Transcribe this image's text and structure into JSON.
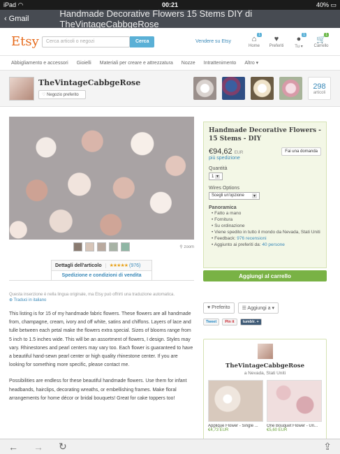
{
  "status": {
    "carrier": "iPad",
    "wifi_icon": "wifi-icon",
    "time": "00:21",
    "battery": "40%"
  },
  "nav": {
    "back_label": "Gmail",
    "title": "Handmade Decorative Flowers 15 Stems DIY di TheVintageCabbgeRose"
  },
  "header": {
    "logo": "Etsy",
    "search_placeholder": "Cerca articoli o negozi",
    "search_button": "Cerca",
    "sell_link": "Vendere su Etsy",
    "icons": [
      {
        "label": "Home",
        "badge": "1",
        "glyph": "⌂"
      },
      {
        "label": "Preferiti",
        "badge": "",
        "glyph": "♥"
      },
      {
        "label": "Tu ▾",
        "badge": "1",
        "glyph": "●"
      },
      {
        "label": "Carrello",
        "badge": "1",
        "glyph": "🛒"
      }
    ]
  },
  "categories": [
    "Abbigliamento e accessori",
    "Gioielli",
    "Materiali per creare e attrezzatura",
    "Nozze",
    "Intrattenimento",
    "Altro ▾"
  ],
  "shop": {
    "name": "TheVintageCabbgeRose",
    "fav_button": "Negozio preferito",
    "item_count": "298",
    "item_label": "articoli"
  },
  "product": {
    "title": "Handmade Decorative Flowers - 15 Stems - DIY",
    "price": "€94,62",
    "currency": "EUR",
    "shipping": "più spedizione",
    "ask_button": "Fai una domanda",
    "quantity_label": "Quantità",
    "quantity_value": "1",
    "wires_label": "Wires Options",
    "wires_value": "Scegli un'opzione",
    "overview_label": "Panoramica",
    "bullets": [
      "Fatto a mano",
      "Fornitura",
      "Su ordinazione",
      "Viene spedito in tutto il mondo da Nevada, Stati Uniti"
    ],
    "feedback_prefix": "Feedback: ",
    "feedback_link": "976 recensioni",
    "favorites_prefix": "Aggiunto ai preferiti da: ",
    "favorites_link": "40 persone",
    "cart_button": "Aggiungi al carrello",
    "zoom_label": "zoom"
  },
  "tabs": {
    "details": "Dettagli dell'articolo",
    "stars": "★★★★★",
    "reviews": "(976)",
    "shipping_tab": "Spedizione e condizioni di vendita"
  },
  "note": {
    "text": "Questa inserzione è nella lingua originale, ma Etsy può offrirti una traduzione automatica.",
    "link": "Traduci in italiano"
  },
  "description": [
    "This listing is for 15 of my handmade fabric flowers. These flowers are all handmade from, champagne, cream, ivory and off white, satins and chiffons. Layers of lace and tulle between each petal make the flowers extra special. Sizes of blooms range from 5 inch to 1.5 inches wide. This will be an assortment of flowers, I design. Styles may vary. Rhinestones and pearl centers may vary too. Each flower is guaranteed to have a beautiful hand-sewn pearl center or high quality rhinestone center. If you are looking for something more specific, please contact me.",
    "Possibilities are endless for these beautiful handmade flowers. Use them for infant headbands, hairclips, decorating wreaths, or embellishing frames. Make floral arrangements for home décor or bridal bouquets! Great for cake toppers too!"
  ],
  "actions": {
    "favorite": "Preferito",
    "add_to": "Aggiungi a ▾",
    "tweet": "Tweet",
    "pin": "Pin it",
    "tumblr": "tumblr. +"
  },
  "shopbox": {
    "name": "TheVintageCabbgeRose",
    "location": "a Nevada, Stati Uniti",
    "items": [
      {
        "caption": "Applique Flower - Single ...",
        "price": "€4,73 EUR"
      },
      {
        "caption": "One Bouquet Flower - Un...",
        "price": "€5,60 EUR"
      }
    ]
  },
  "toolbar": {
    "back": "←",
    "forward": "→",
    "reload": "↻",
    "share": "⇪"
  }
}
